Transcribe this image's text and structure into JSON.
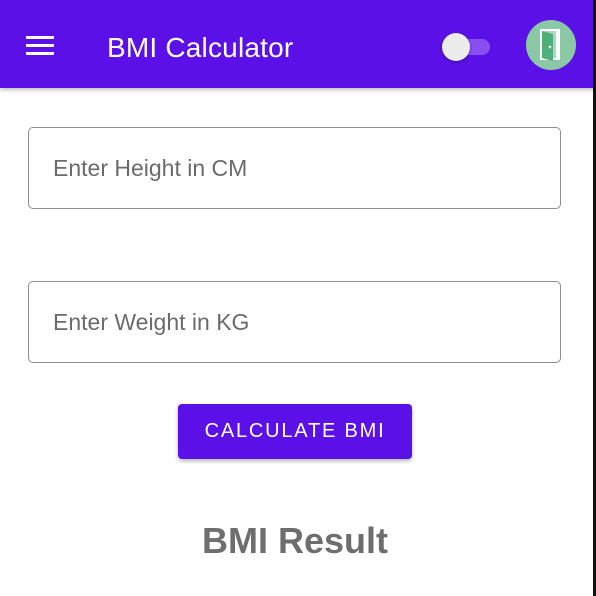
{
  "app_bar": {
    "title": "BMI Calculator",
    "menu_icon": "hamburger-menu-icon",
    "theme_toggle": {
      "state": "off"
    },
    "avatar_icon": "door-icon",
    "colors": {
      "primary": "#5a10e6",
      "avatar_bg": "#8bc9a6"
    }
  },
  "form": {
    "height_field": {
      "placeholder": "Enter Height in CM",
      "value": ""
    },
    "weight_field": {
      "placeholder": "Enter Weight in KG",
      "value": ""
    },
    "calculate_label": "CALCULATE BMI"
  },
  "result": {
    "title": "BMI Result"
  }
}
